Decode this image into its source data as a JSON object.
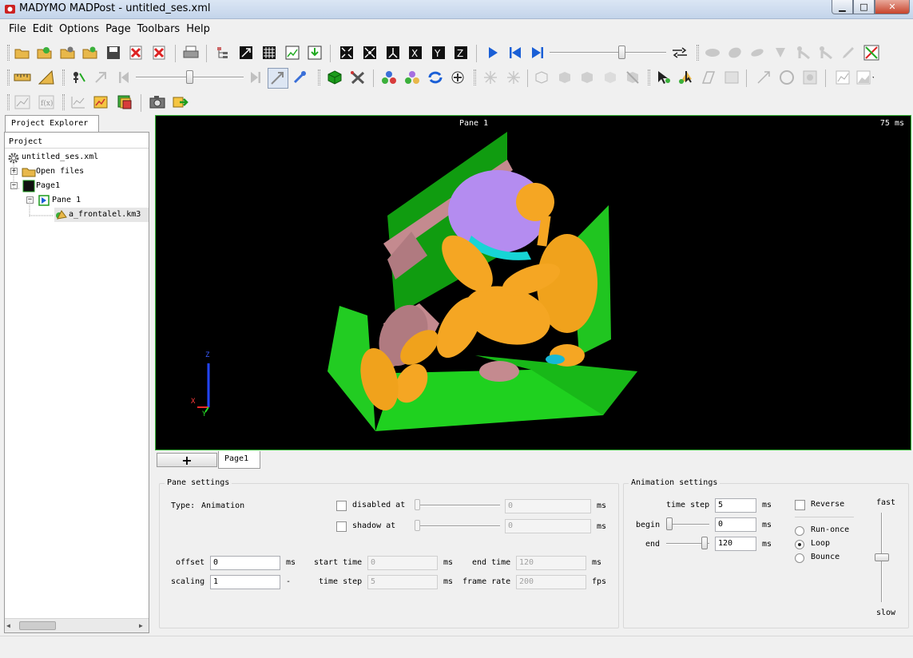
{
  "window": {
    "title": "MADYMO MADPost - untitled_ses.xml"
  },
  "menu": [
    "File",
    "Edit",
    "Options",
    "Page",
    "Toolbars",
    "Help"
  ],
  "toolbar": {
    "row1_icons": [
      "open-icon",
      "reload-icon",
      "open-session-icon",
      "add-session-icon",
      "save-icon",
      "close-file-icon",
      "close-all-icon",
      "print-icon",
      "tree-icon",
      "fit-icon",
      "grid-icon",
      "chart-image-icon",
      "export-icon",
      "zoom-fit-icon",
      "zoom-all-icon",
      "axes-icon",
      "view-x-icon",
      "view-y-icon",
      "view-z-icon",
      "play-icon",
      "rewind-icon",
      "step-end-icon",
      "link-icon",
      "ghost-1-icon",
      "ghost-2-icon",
      "ghost-3-icon",
      "arrow-down-icon",
      "dummy-icon",
      "dummy-2-icon",
      "pen-icon",
      "stretch-icon"
    ],
    "row2_icons": [
      "ruler-icon",
      "angle-icon",
      "select-icon",
      "cursor-gray-icon",
      "step-back-icon",
      "step-forward-icon",
      "pick-icon",
      "measure-icon",
      "cube-icon",
      "tools-icon",
      "molecule-icon",
      "molecule-2-icon",
      "refresh-icon",
      "plus-icon",
      "star-icon",
      "star-2-icon",
      "box-wire-icon",
      "box-1-icon",
      "box-2-icon",
      "box-3-icon",
      "hide-icon",
      "pointer-icon",
      "pointer-2-icon",
      "shape-icon",
      "image-gray-icon",
      "vector-icon",
      "circle-icon",
      "picture-icon",
      "chart-line-icon",
      "chart-area-icon"
    ],
    "row3_icons": [
      "graph-icon",
      "function-icon",
      "plot-edit-icon",
      "image-edit-icon",
      "layers-icon",
      "camera-icon",
      "export-image-icon"
    ]
  },
  "explorer": {
    "tab": "Project Explorer",
    "header": "Project",
    "items": [
      "untitled_ses.xml",
      "Open files",
      "Page1",
      "Pane 1",
      "a_frontalel.km3"
    ]
  },
  "viewport": {
    "pane_label": "Pane 1",
    "time_label": "75 ms",
    "axis_z": "Z",
    "axis_x": "X",
    "axis_y": "Y"
  },
  "page_tabs": {
    "add_label": "+",
    "tab": "Page1"
  },
  "pane_settings": {
    "title": "Pane settings",
    "type_label": "Type:",
    "type_value": "Animation",
    "disabled_at": "disabled at",
    "disabled_value": "0",
    "disabled_unit": "ms",
    "shadow_at": "shadow at",
    "shadow_value": "0",
    "shadow_unit": "ms",
    "offset_label": "offset",
    "offset_value": "0",
    "offset_unit": "ms",
    "scaling_label": "scaling",
    "scaling_value": "1",
    "scaling_unit": "-",
    "start_time_label": "start time",
    "start_time_value": "0",
    "start_time_unit": "ms",
    "end_time_label": "end time",
    "end_time_value": "120",
    "end_time_unit": "ms",
    "time_step_label": "time step",
    "time_step_value": "5",
    "time_step_unit": "ms",
    "frame_rate_label": "frame rate",
    "frame_rate_value": "200",
    "frame_rate_unit": "fps"
  },
  "animation_settings": {
    "title": "Animation settings",
    "time_step_label": "time step",
    "time_step_value": "5",
    "time_step_unit": "ms",
    "begin_label": "begin",
    "begin_value": "0",
    "begin_unit": "ms",
    "end_label": "end",
    "end_value": "120",
    "end_unit": "ms",
    "reverse_label": "Reverse",
    "modes": [
      "Run-once",
      "Loop",
      "Bounce"
    ],
    "selected_mode": "Loop",
    "speed_fast": "fast",
    "speed_slow": "slow"
  },
  "colors": {
    "viewport_bg": "#000000",
    "floor_green": "#1fd11f",
    "dummy_orange": "#f5a623",
    "airbag_purple": "#b48cf0",
    "steering_pink": "#c48a8f",
    "pane_border": "#3cba3c"
  }
}
